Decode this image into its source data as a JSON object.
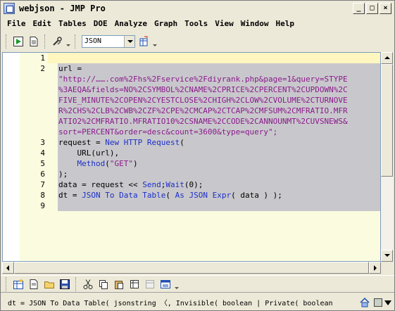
{
  "window": {
    "title": "webjson - JMP Pro"
  },
  "menu": [
    "File",
    "Edit",
    "Tables",
    "DOE",
    "Analyze",
    "Graph",
    "Tools",
    "View",
    "Window",
    "Help"
  ],
  "toolbar": {
    "combo_value": "JSON"
  },
  "editor": {
    "line_numbers": [
      "1",
      "2",
      "3",
      "4",
      "5",
      "6",
      "7",
      "8",
      "9"
    ],
    "lines": {
      "l2": "url =",
      "l2a": "\"http://…….com%2Fhs%2Fservice%2Fdiyrank.php&page=1&query=STYPE",
      "l2b": "%3AEQA&fields=NO%2CSYMBOL%2CNAME%2CPRICE%2CPERCENT%2CUPDOWN%2C",
      "l2c": "FIVE_MINUTE%2COPEN%2CYESTCLOSE%2CHIGH%2CLOW%2CVOLUME%2CTURNOVE",
      "l2d": "R%2CHS%2CLB%2CWB%2CZF%2CPE%2CMCAP%2CTCAP%2CMFSUM%2CMFRATIO.MFR",
      "l2e": "ATIO2%2CMFRATIO.MFRATIO10%2CSNAME%2CCODE%2CANNOUNMT%2CUVSNEWS&",
      "l2f": "sort=PERCENT&order=desc&count=3600&type=query\";",
      "l3a": "request = ",
      "l3b": "New HTTP Request",
      "l3c": "(",
      "l4a": "    URL(url),",
      "l5a": "    ",
      "l5b": "Method",
      "l5c": "(",
      "l5d": "\"GET\"",
      "l5e": ")",
      "l6a": ");",
      "l7a": "data = request << ",
      "l7b": "Send",
      "l7c": ";",
      "l7d": "Wait",
      "l7e": "(0);",
      "l8a": "dt = ",
      "l8b": "JSON To Data Table",
      "l8c": "( ",
      "l8d": "As JSON Expr",
      "l8e": "( data ) );"
    }
  },
  "status": {
    "text": "dt = JSON To Data Table( jsonstring 〈, Invisible( boolean | Private( boolean"
  }
}
